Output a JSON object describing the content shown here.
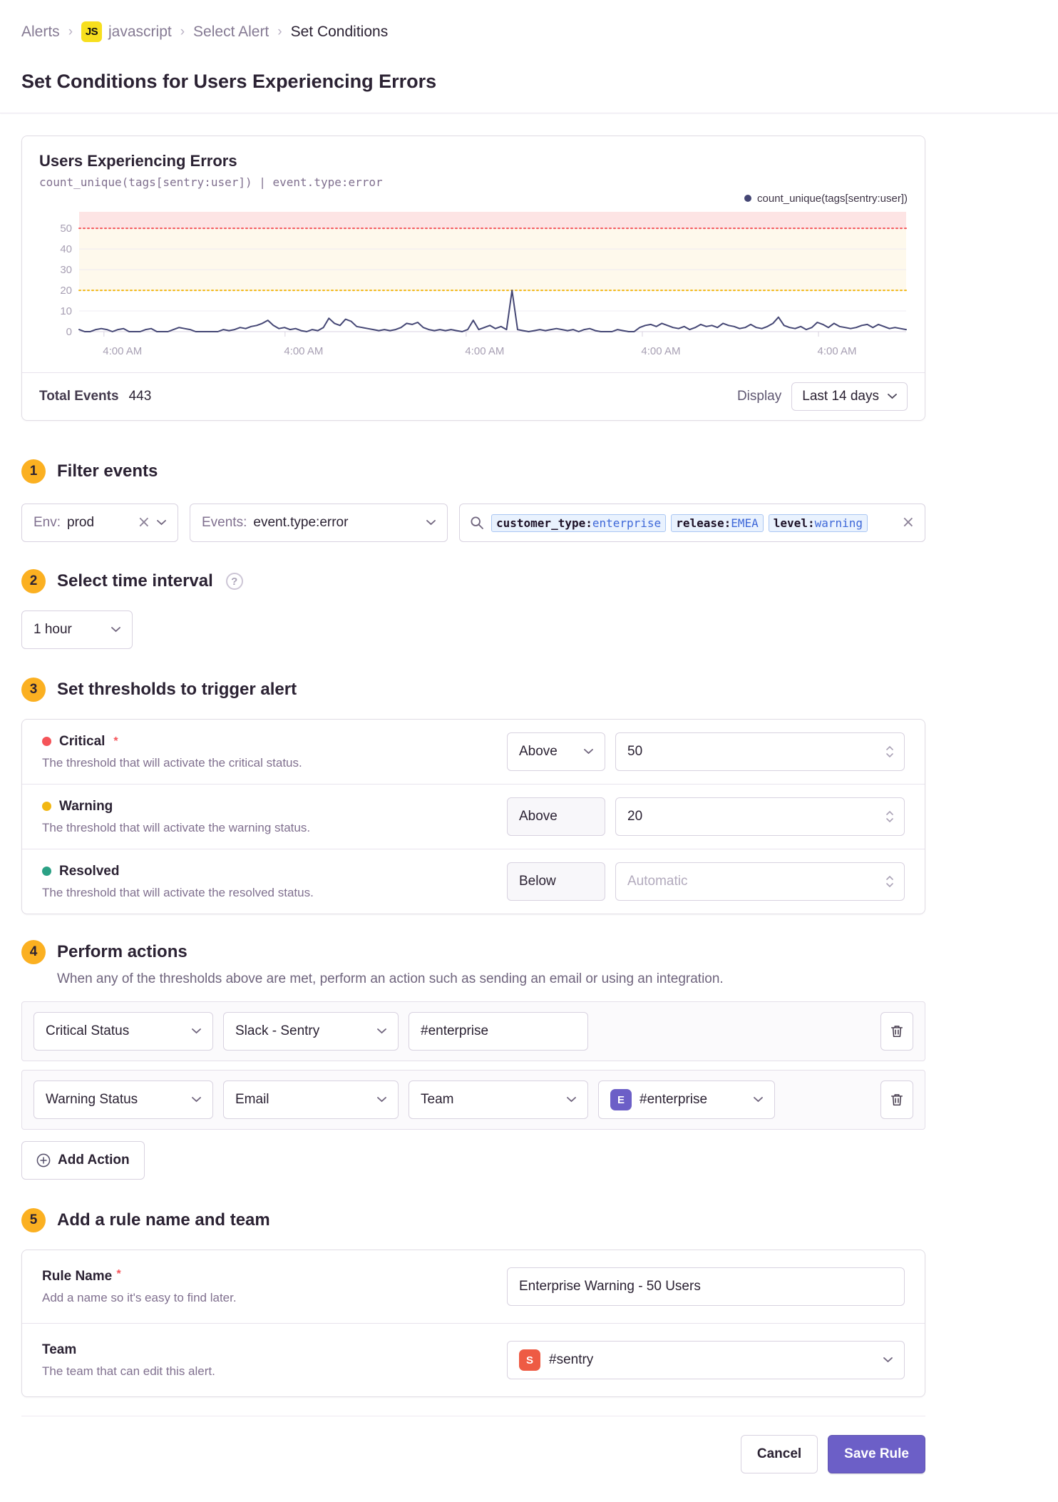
{
  "breadcrumb": {
    "items": [
      "Alerts",
      "javascript",
      "Select Alert",
      "Set Conditions"
    ],
    "project_badge": "JS",
    "separator": "›"
  },
  "page": {
    "title": "Set Conditions for Users Experiencing Errors"
  },
  "chart_panel": {
    "title": "Users Experiencing Errors",
    "subtitle": "count_unique(tags[sentry:user]) | event.type:error",
    "legend": "count_unique(tags[sentry:user])",
    "total_events_label": "Total Events",
    "total_events_value": "443",
    "display_label": "Display",
    "display_value": "Last 14 days"
  },
  "chart_data": {
    "type": "line",
    "title": "Users Experiencing Errors",
    "series": [
      {
        "name": "count_unique(tags[sentry:user])",
        "values": [
          1,
          0,
          0,
          1,
          1.5,
          1,
          0,
          1,
          1.5,
          0,
          0,
          0,
          1,
          1.5,
          0,
          0,
          0,
          1,
          2,
          1.5,
          1,
          0,
          0,
          0,
          0,
          0,
          1,
          0.5,
          1,
          2,
          1.5,
          2.5,
          3,
          4,
          5.5,
          3,
          1.5,
          2,
          1,
          1.5,
          0.5,
          0,
          1,
          0.5,
          2,
          6.5,
          4,
          3,
          6,
          5,
          2.5,
          2,
          1.5,
          1,
          0.5,
          1,
          0.5,
          1,
          2,
          4,
          3.5,
          4.5,
          2,
          1,
          0.5,
          1,
          0.5,
          1,
          0.5,
          0,
          1,
          5.5,
          1,
          2,
          3,
          1.5,
          2.5,
          1,
          20,
          1,
          0.5,
          0,
          0.5,
          1,
          0.5,
          1,
          1.5,
          1,
          0.5,
          1,
          0,
          1,
          1.5,
          0.5,
          0,
          0,
          0,
          1,
          0.5,
          0,
          0,
          2,
          3,
          3.5,
          2.5,
          4,
          3,
          2,
          1.5,
          2.5,
          1,
          2,
          3.5,
          2.5,
          3,
          2,
          4,
          3,
          2.5,
          1.5,
          2,
          3.5,
          2,
          1.5,
          2.5,
          4,
          7,
          3,
          2,
          1.5,
          2.5,
          1,
          2,
          4.5,
          3.5,
          2,
          4,
          2.5,
          2,
          1.5,
          2,
          3,
          3.5,
          2,
          3.5,
          2.5,
          1.5,
          2,
          1.5,
          1
        ]
      }
    ],
    "ylim": [
      0,
      58
    ],
    "yticks": [
      0,
      10,
      20,
      30,
      40,
      50
    ],
    "xtick_labels": [
      "4:00 AM",
      "4:00 AM",
      "4:00 AM",
      "4:00 AM",
      "4:00 AM"
    ],
    "xtick_positions": [
      0.03,
      0.249,
      0.468,
      0.681,
      0.894
    ],
    "thresholds": {
      "critical": 50,
      "warning": 20
    },
    "grid": true,
    "legend_position": "top-right"
  },
  "filter": {
    "badge": "1",
    "title": "Filter events",
    "env": {
      "label": "Env:",
      "value": "prod"
    },
    "events": {
      "label": "Events:",
      "value": "event.type:error"
    },
    "search": {
      "tokens": [
        {
          "key": "customer_type:",
          "value": "enterprise"
        },
        {
          "key": "release:",
          "value": "EMEA"
        },
        {
          "key": "level:",
          "value": "warning"
        }
      ]
    }
  },
  "interval": {
    "badge": "2",
    "title": "Select time interval",
    "value": "1 hour"
  },
  "thresholds": {
    "badge": "3",
    "title": "Set thresholds to trigger alert",
    "rows": [
      {
        "name": "Critical",
        "required": "*",
        "desc": "The threshold that will activate the critical status.",
        "condition": "Above",
        "value": "50"
      },
      {
        "name": "Warning",
        "desc": "The threshold that will activate the warning status.",
        "condition": "Above",
        "value": "20"
      },
      {
        "name": "Resolved",
        "desc": "The threshold that will activate the resolved status.",
        "condition": "Below",
        "placeholder": "Automatic"
      }
    ]
  },
  "actions": {
    "badge": "4",
    "title": "Perform actions",
    "description": "When any of the thresholds above are met, perform an action such as sending an email or using an integration.",
    "row1": {
      "trigger": "Critical Status",
      "service": "Slack - Sentry",
      "target": "#enterprise"
    },
    "row2": {
      "trigger": "Warning Status",
      "service": "Email",
      "target_type": "Team",
      "team_badge": "E",
      "team_value": "#enterprise"
    },
    "add_button": "Add Action"
  },
  "naming": {
    "badge": "5",
    "title": "Add a rule name and team",
    "rule_name": {
      "label": "Rule Name",
      "required": "*",
      "desc": "Add a name so it's easy to find later.",
      "value": "Enterprise Warning - 50 Users"
    },
    "team": {
      "label": "Team",
      "desc": "The team that can edit this alert.",
      "badge": "S",
      "value": "#sentry"
    }
  },
  "footer": {
    "cancel": "Cancel",
    "save": "Save Rule"
  },
  "colors": {
    "accent": "#6c5fc7",
    "series": "#444674",
    "critical": "#f55459",
    "warning": "#f2b712",
    "resolved": "#2ba185",
    "step_badge": "#fbb021",
    "js_badge": "#f7df1e",
    "team_avatar": "#ee5b44",
    "enterprise_avatar": "#6c5fc7",
    "chip_bg": "#e9f2fe",
    "critical_band": "rgba(245,84,89,0.16)",
    "warning_band": "rgba(245,176,18,0.08)"
  }
}
